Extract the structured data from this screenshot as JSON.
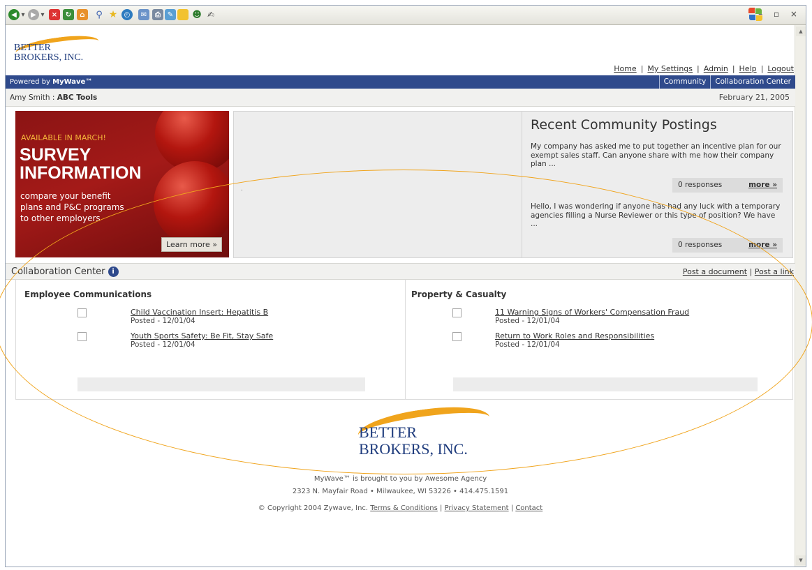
{
  "browser": {
    "toolbar_icons": [
      "back-icon",
      "forward-icon",
      "stop-icon",
      "refresh-icon",
      "home-icon",
      "search-icon",
      "favorites-icon",
      "history-icon",
      "mail-icon",
      "print-icon",
      "edit-icon",
      "messenger-icon",
      "research-icon",
      "tools-icon"
    ],
    "window_controls": "– ▫ ×"
  },
  "header": {
    "logo_line1": "BETTER",
    "logo_line2": "BROKERS, INC.",
    "links": [
      "Home",
      "My Settings",
      "Admin",
      "Help",
      "Logout"
    ]
  },
  "bluebar": {
    "powered_prefix": "Powered by ",
    "powered_brand": "MyWave™",
    "tabs": [
      "Community",
      "Collaboration Center"
    ]
  },
  "userbar": {
    "user": "Amy Smith",
    "separator": " : ",
    "tool": "ABC Tools",
    "date": "February 21, 2005"
  },
  "banner": {
    "available": "AVAILABLE IN MARCH!",
    "headline1": "SURVEY",
    "headline2": "INFORMATION",
    "sub1": "compare your benefit",
    "sub2": "plans and P&C programs",
    "sub3": "to other employers",
    "button": "Learn more »"
  },
  "midbox": {
    "dot": "."
  },
  "postings": {
    "title": "Recent Community Postings",
    "items": [
      {
        "text": "My company has asked me to put together an incentive plan for our exempt sales staff. Can anyone share with me how their company plan ...",
        "responses": "0 responses",
        "more": "more »"
      },
      {
        "text": "Hello, I was wondering if anyone has had any luck with a temporary agencies filling a Nurse Reviewer or this type of position? We have ...",
        "responses": "0 responses",
        "more": "more »"
      }
    ]
  },
  "collab": {
    "title": "Collaboration Center",
    "info": "i",
    "post_document": "Post a document",
    "separator": " | ",
    "post_link": "Post a link",
    "panels": [
      {
        "title": "Employee Communications",
        "items": [
          {
            "title": "Child Vaccination Insert: Hepatitis B",
            "date": "Posted - 12/01/04"
          },
          {
            "title": "Youth Sports Safety: Be Fit, Stay Safe",
            "date": "Posted - 12/01/04"
          }
        ]
      },
      {
        "title": "Property & Casualty",
        "items": [
          {
            "title": "11 Warning Signs of Workers' Compensation Fraud",
            "date": "Posted - 12/01/04"
          },
          {
            "title": "Return to Work Roles and Responsibilities",
            "date": "Posted - 12/01/04"
          }
        ]
      }
    ]
  },
  "footer": {
    "logo_line1": "BETTER",
    "logo_line2": "BROKERS, INC.",
    "line1": "MyWave™ is brought to you by Awesome Agency",
    "line2": "2323 N. Mayfair Road • Milwaukee, WI 53226 • 414.475.1591",
    "copyright": "© Copyright 2004 Zywave, Inc. ",
    "terms": "Terms & Conditions",
    "sep": " | ",
    "privacy": "Privacy Statement",
    "contact": "Contact"
  },
  "colors": {
    "accent_orange": "#f0a41c",
    "nav_blue": "#2f4a8c",
    "banner_red": "#a41a18"
  }
}
